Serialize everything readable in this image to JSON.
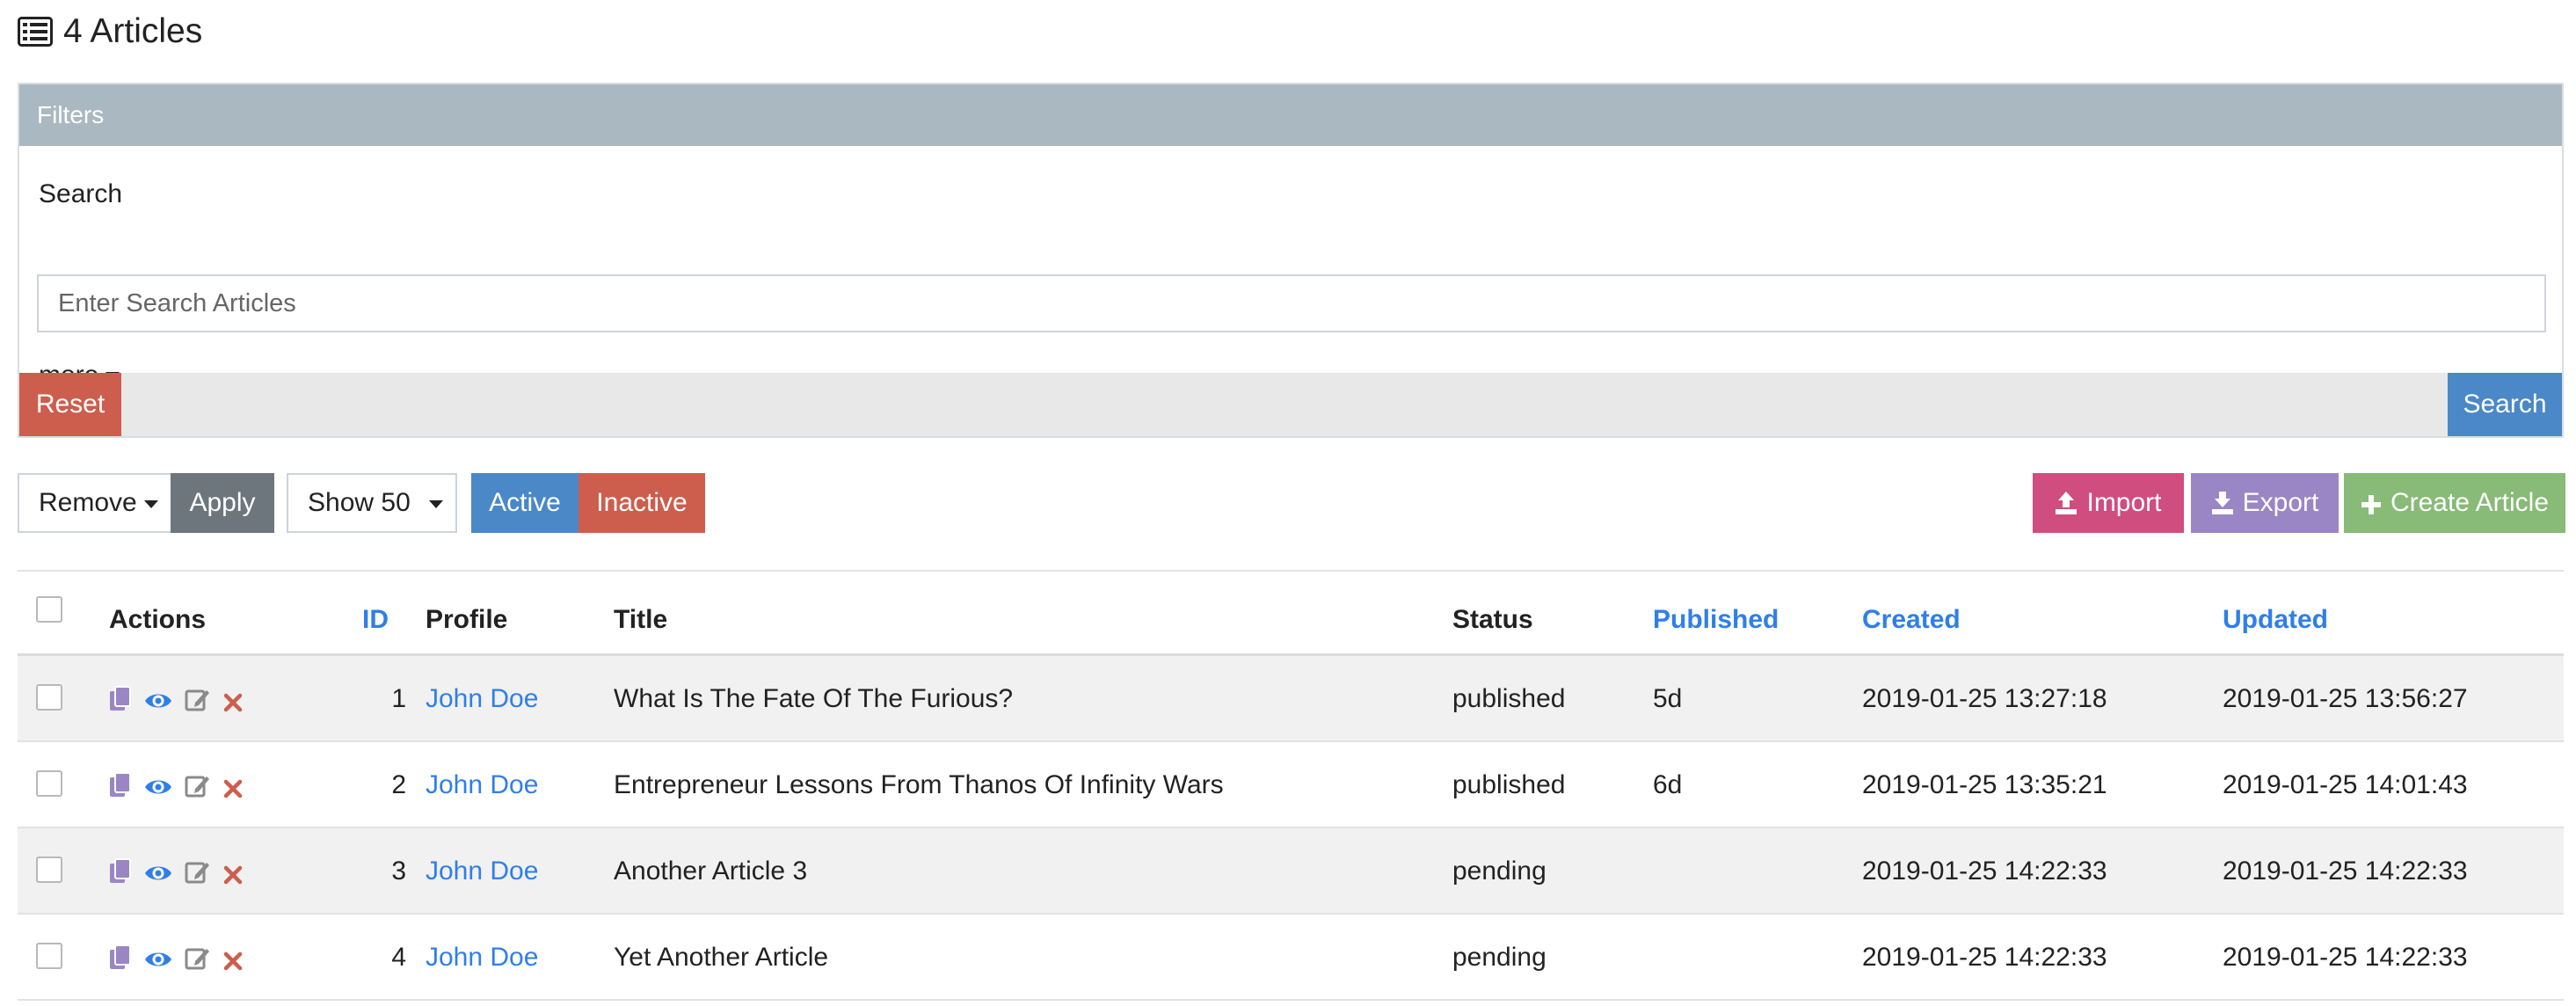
{
  "header": {
    "title": "4 Articles",
    "icon": "list-alt-icon"
  },
  "filters": {
    "title": "Filters",
    "search_label": "Search",
    "search_placeholder": "Enter Search Articles",
    "search_value": "",
    "more_label": "more",
    "reset_label": "Reset",
    "search_button_label": "Search"
  },
  "toolbar": {
    "bulk_action": "Remove",
    "apply_label": "Apply",
    "page_size": "Show 50",
    "active_label": "Active",
    "inactive_label": "Inactive",
    "import_label": "Import",
    "export_label": "Export",
    "create_label": "Create Article"
  },
  "table": {
    "columns": {
      "actions": "Actions",
      "id": "ID",
      "profile": "Profile",
      "title": "Title",
      "status": "Status",
      "published": "Published",
      "created": "Created",
      "updated": "Updated"
    },
    "rows": [
      {
        "id": "1",
        "profile": "John Doe",
        "title": "What Is The Fate Of The Furious?",
        "status": "published",
        "published": "5d",
        "created": "2019-01-25 13:27:18",
        "updated": "2019-01-25 13:56:27"
      },
      {
        "id": "2",
        "profile": "John Doe",
        "title": "Entrepreneur Lessons From Thanos Of Infinity Wars",
        "status": "published",
        "published": "6d",
        "created": "2019-01-25 13:35:21",
        "updated": "2019-01-25 14:01:43"
      },
      {
        "id": "3",
        "profile": "John Doe",
        "title": "Another Article 3",
        "status": "pending",
        "published": "",
        "created": "2019-01-25 14:22:33",
        "updated": "2019-01-25 14:22:33"
      },
      {
        "id": "4",
        "profile": "John Doe",
        "title": "Yet Another Article",
        "status": "pending",
        "published": "",
        "created": "2019-01-25 14:22:33",
        "updated": "2019-01-25 14:22:33"
      }
    ]
  },
  "colors": {
    "accent_blue": "#4a88c7",
    "link_blue": "#2f7fe8",
    "danger_red": "#cd5e4d",
    "import_pink": "#d04d7f",
    "export_purple": "#9a86c4",
    "create_green": "#88ba78",
    "filters_header": "#aab8c1"
  }
}
